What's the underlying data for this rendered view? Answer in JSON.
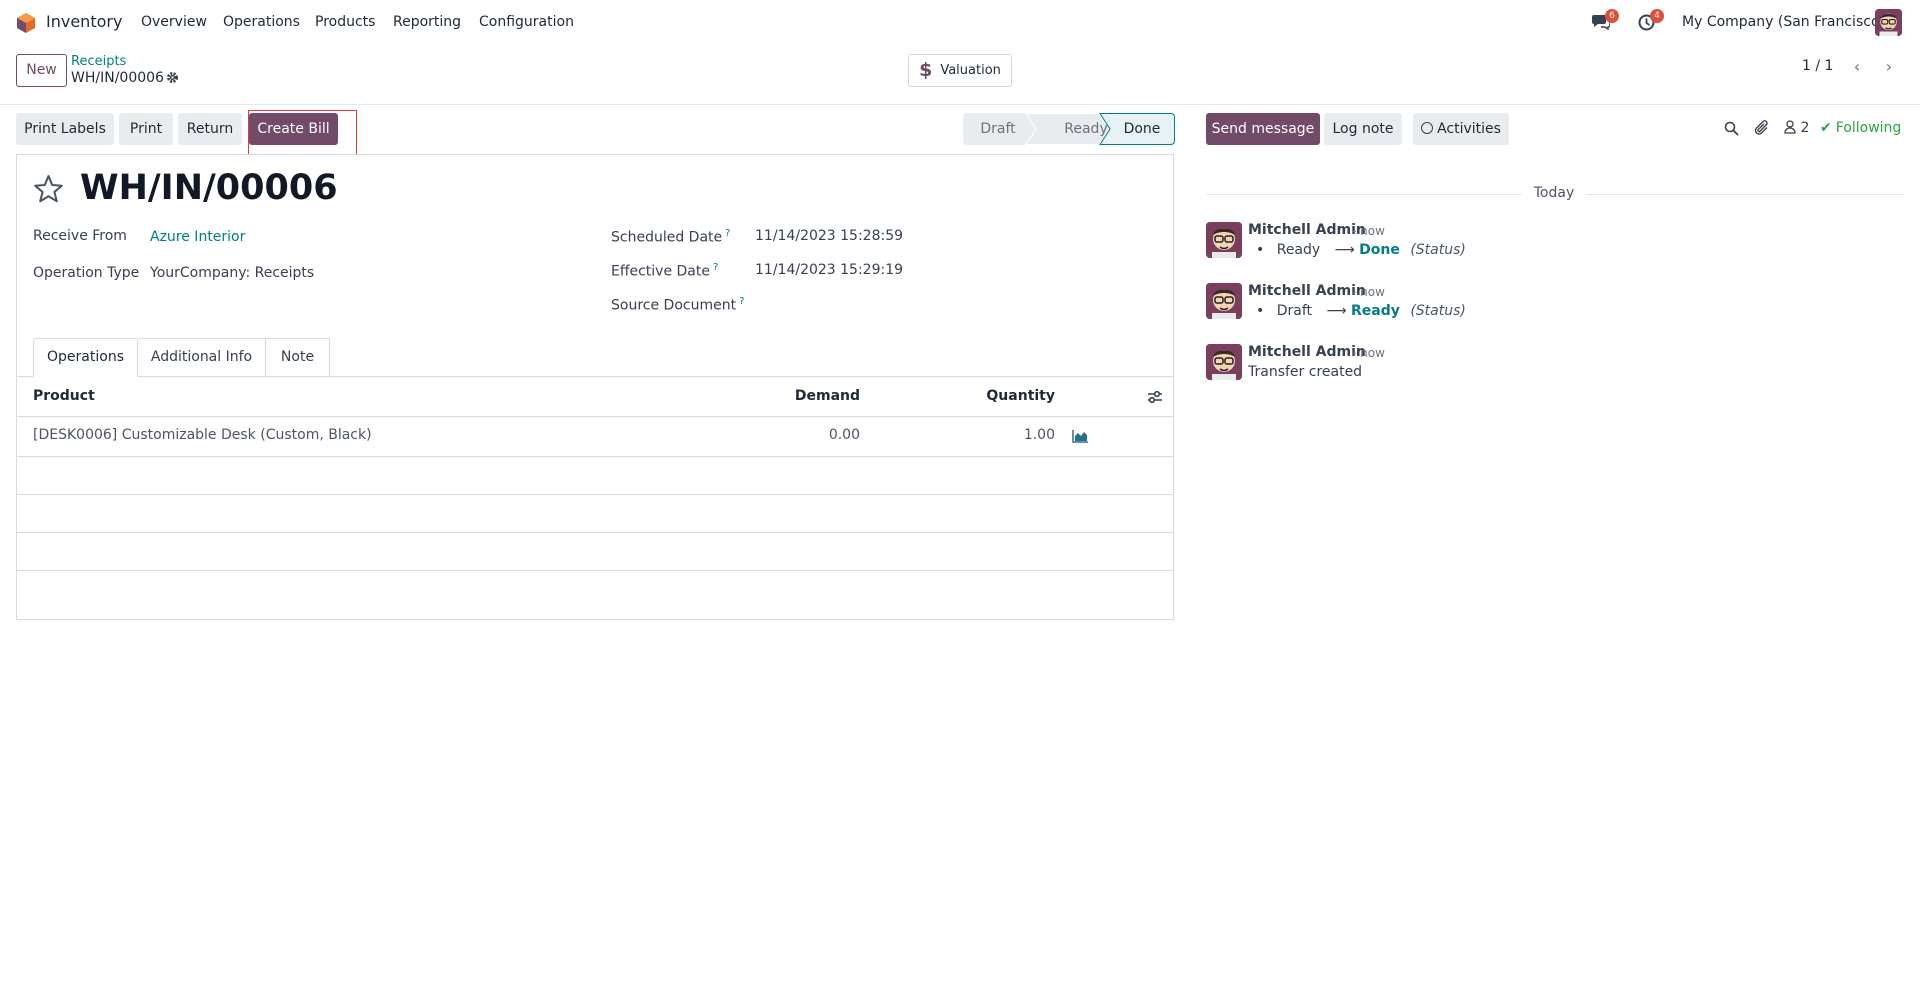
{
  "navbar": {
    "app_name": "Inventory",
    "menu": [
      "Overview",
      "Operations",
      "Products",
      "Reporting",
      "Configuration"
    ],
    "messages_count": "6",
    "activities_count": "4",
    "company": "My Company (San Francisco)"
  },
  "control_panel": {
    "new_label": "New",
    "breadcrumb_parent": "Receipts",
    "breadcrumb_current": "WH/IN/00006",
    "valuation_label": "Valuation",
    "pager": "1 / 1"
  },
  "actions": {
    "print_labels": "Print Labels",
    "print": "Print",
    "return": "Return",
    "create_bill": "Create Bill"
  },
  "statusbar": [
    "Draft",
    "Ready",
    "Done"
  ],
  "form": {
    "title": "WH/IN/00006",
    "receive_from_label": "Receive From",
    "receive_from_value": "Azure Interior",
    "operation_type_label": "Operation Type",
    "operation_type_value": "YourCompany: Receipts",
    "scheduled_date_label": "Scheduled Date",
    "scheduled_date_value": "11/14/2023 15:28:59",
    "effective_date_label": "Effective Date",
    "effective_date_value": "11/14/2023 15:29:19",
    "source_document_label": "Source Document",
    "help_mark": "?",
    "tabs": [
      "Operations",
      "Additional Info",
      "Note"
    ],
    "table": {
      "headers": {
        "product": "Product",
        "demand": "Demand",
        "quantity": "Quantity"
      },
      "rows": [
        {
          "product": "[DESK0006] Customizable Desk (Custom, Black)",
          "demand": "0.00",
          "quantity": "1.00"
        }
      ]
    }
  },
  "chatter": {
    "send_message": "Send message",
    "log_note": "Log note",
    "activities": "Activities",
    "followers_count": "2",
    "following": "Following",
    "day_separator": "Today",
    "messages": [
      {
        "author": "Mitchell Admin",
        "time": "- now",
        "from": "Ready",
        "to": "Done",
        "field": "(Status)"
      },
      {
        "author": "Mitchell Admin",
        "time": "- now",
        "from": "Draft",
        "to": "Ready",
        "field": "(Status)"
      },
      {
        "author": "Mitchell Admin",
        "time": "- now",
        "body": "Transfer created"
      }
    ]
  },
  "colors": {
    "primary": "#714b67",
    "link": "#017e84",
    "success": "#28a745",
    "badge": "#e04e3c"
  }
}
